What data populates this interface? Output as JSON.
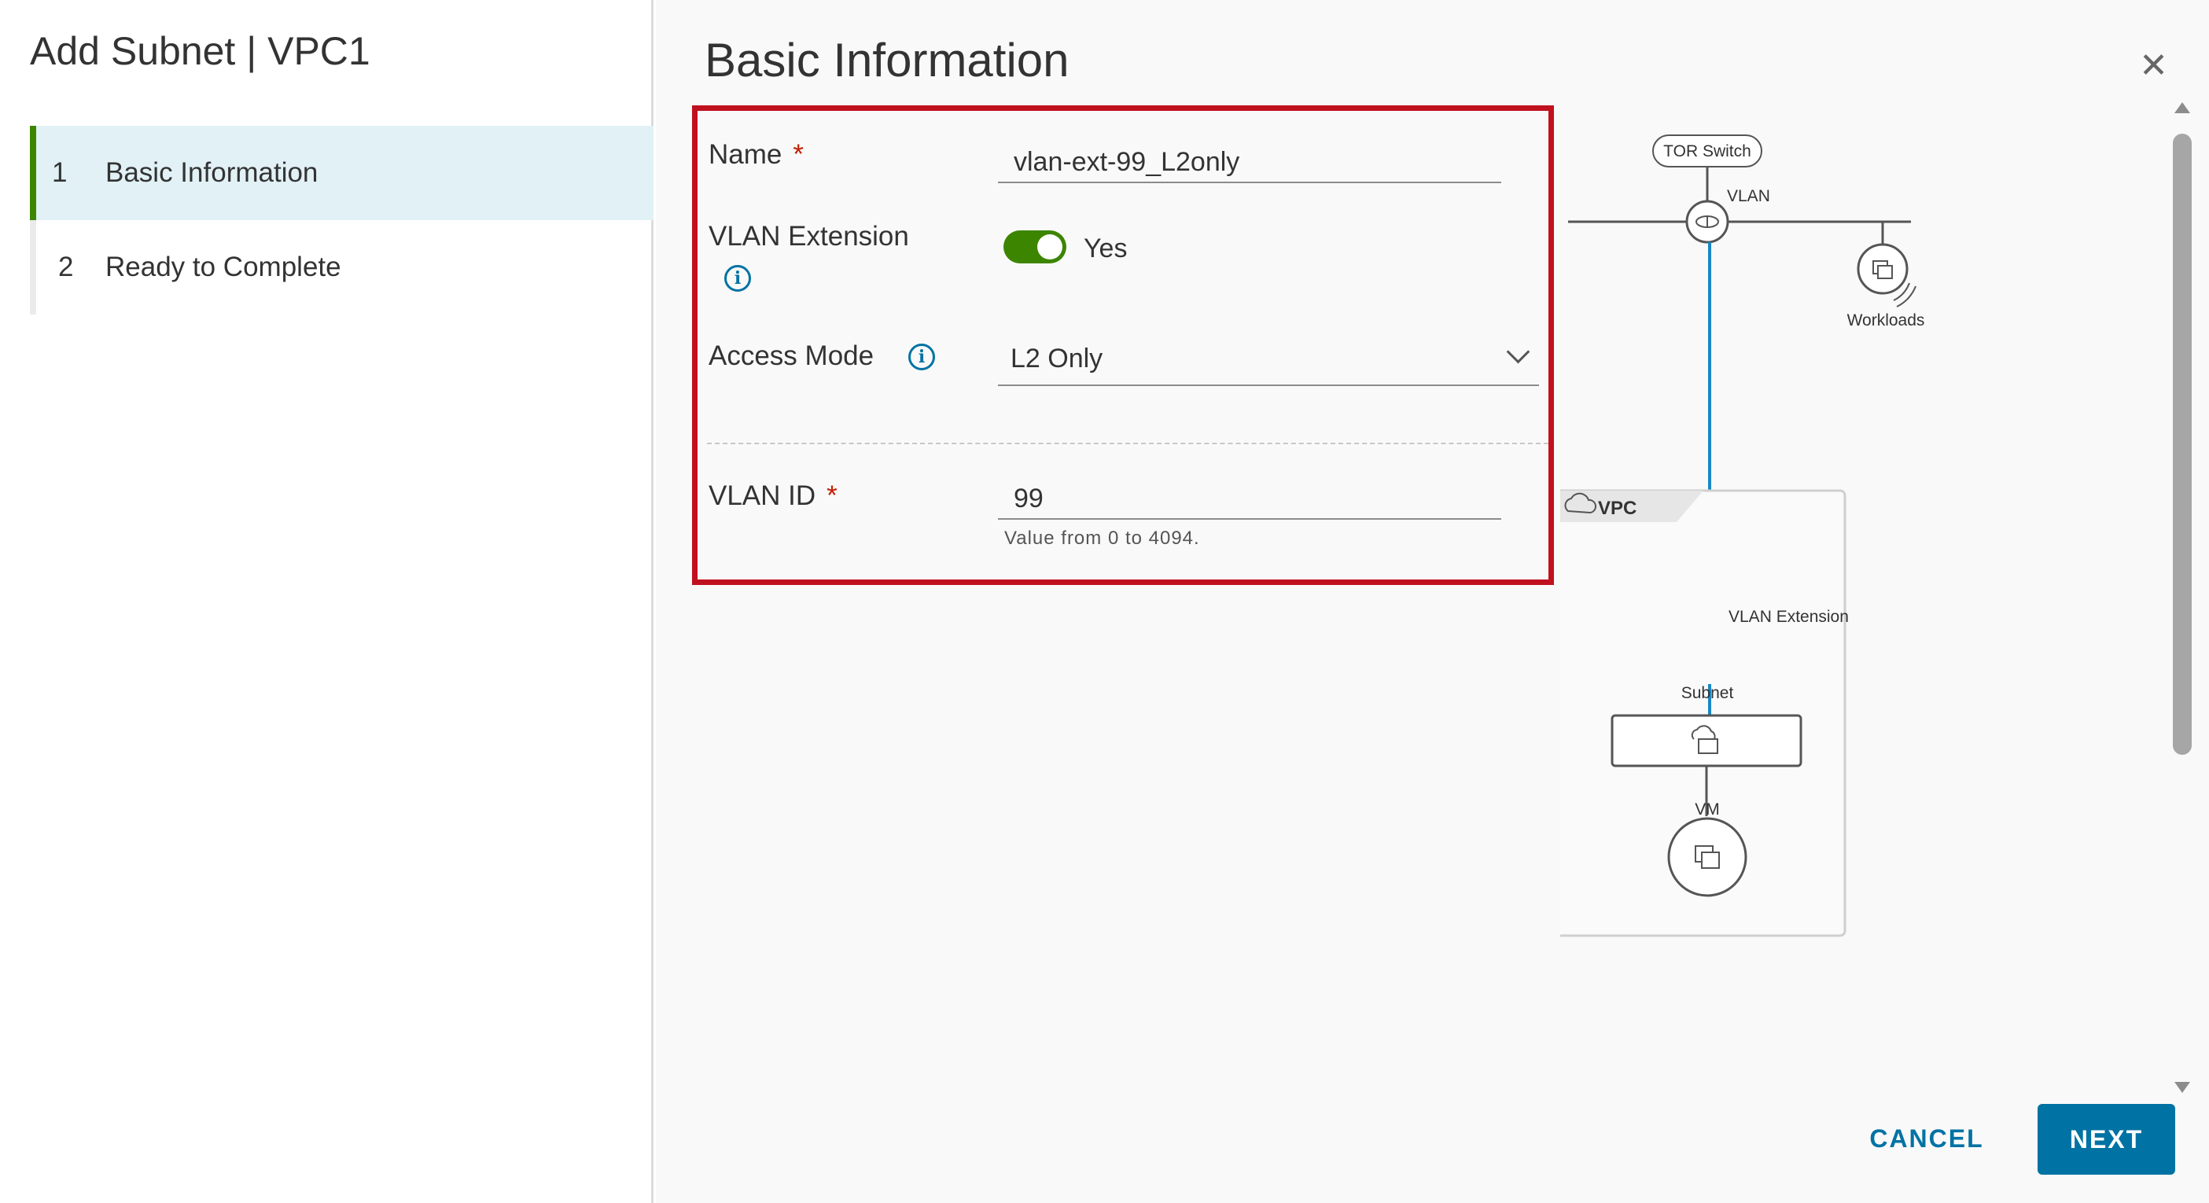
{
  "wizard": {
    "title": "Add Subnet | VPC1",
    "steps": [
      {
        "number": "1",
        "label": "Basic Information",
        "active": true
      },
      {
        "number": "2",
        "label": "Ready to Complete",
        "active": false
      }
    ]
  },
  "main": {
    "title": "Basic Information",
    "close_icon": "close-icon"
  },
  "form": {
    "name": {
      "label": "Name",
      "required_mark": "*",
      "value": "vlan-ext-99_L2only"
    },
    "vlan_extension": {
      "label": "VLAN Extension",
      "state_label": "Yes",
      "enabled": true
    },
    "access_mode": {
      "label": "Access Mode",
      "value": "L2 Only"
    },
    "vlan_id": {
      "label": "VLAN ID",
      "required_mark": "*",
      "value": "99",
      "helper": "Value from 0 to 4094."
    }
  },
  "diagram": {
    "tor_switch": "TOR Switch",
    "vlan": "VLAN",
    "workloads": "Workloads",
    "vpc": "VPC",
    "vlan_extension": "VLAN Extension",
    "subnet": "Subnet",
    "vm": "VM"
  },
  "footer": {
    "cancel_label": "CANCEL",
    "next_label": "NEXT"
  },
  "colors": {
    "accent_green": "#3c8500",
    "primary_blue": "#0072a3",
    "highlight_red": "#c0111f",
    "active_step_bg": "#e1f1f6"
  }
}
